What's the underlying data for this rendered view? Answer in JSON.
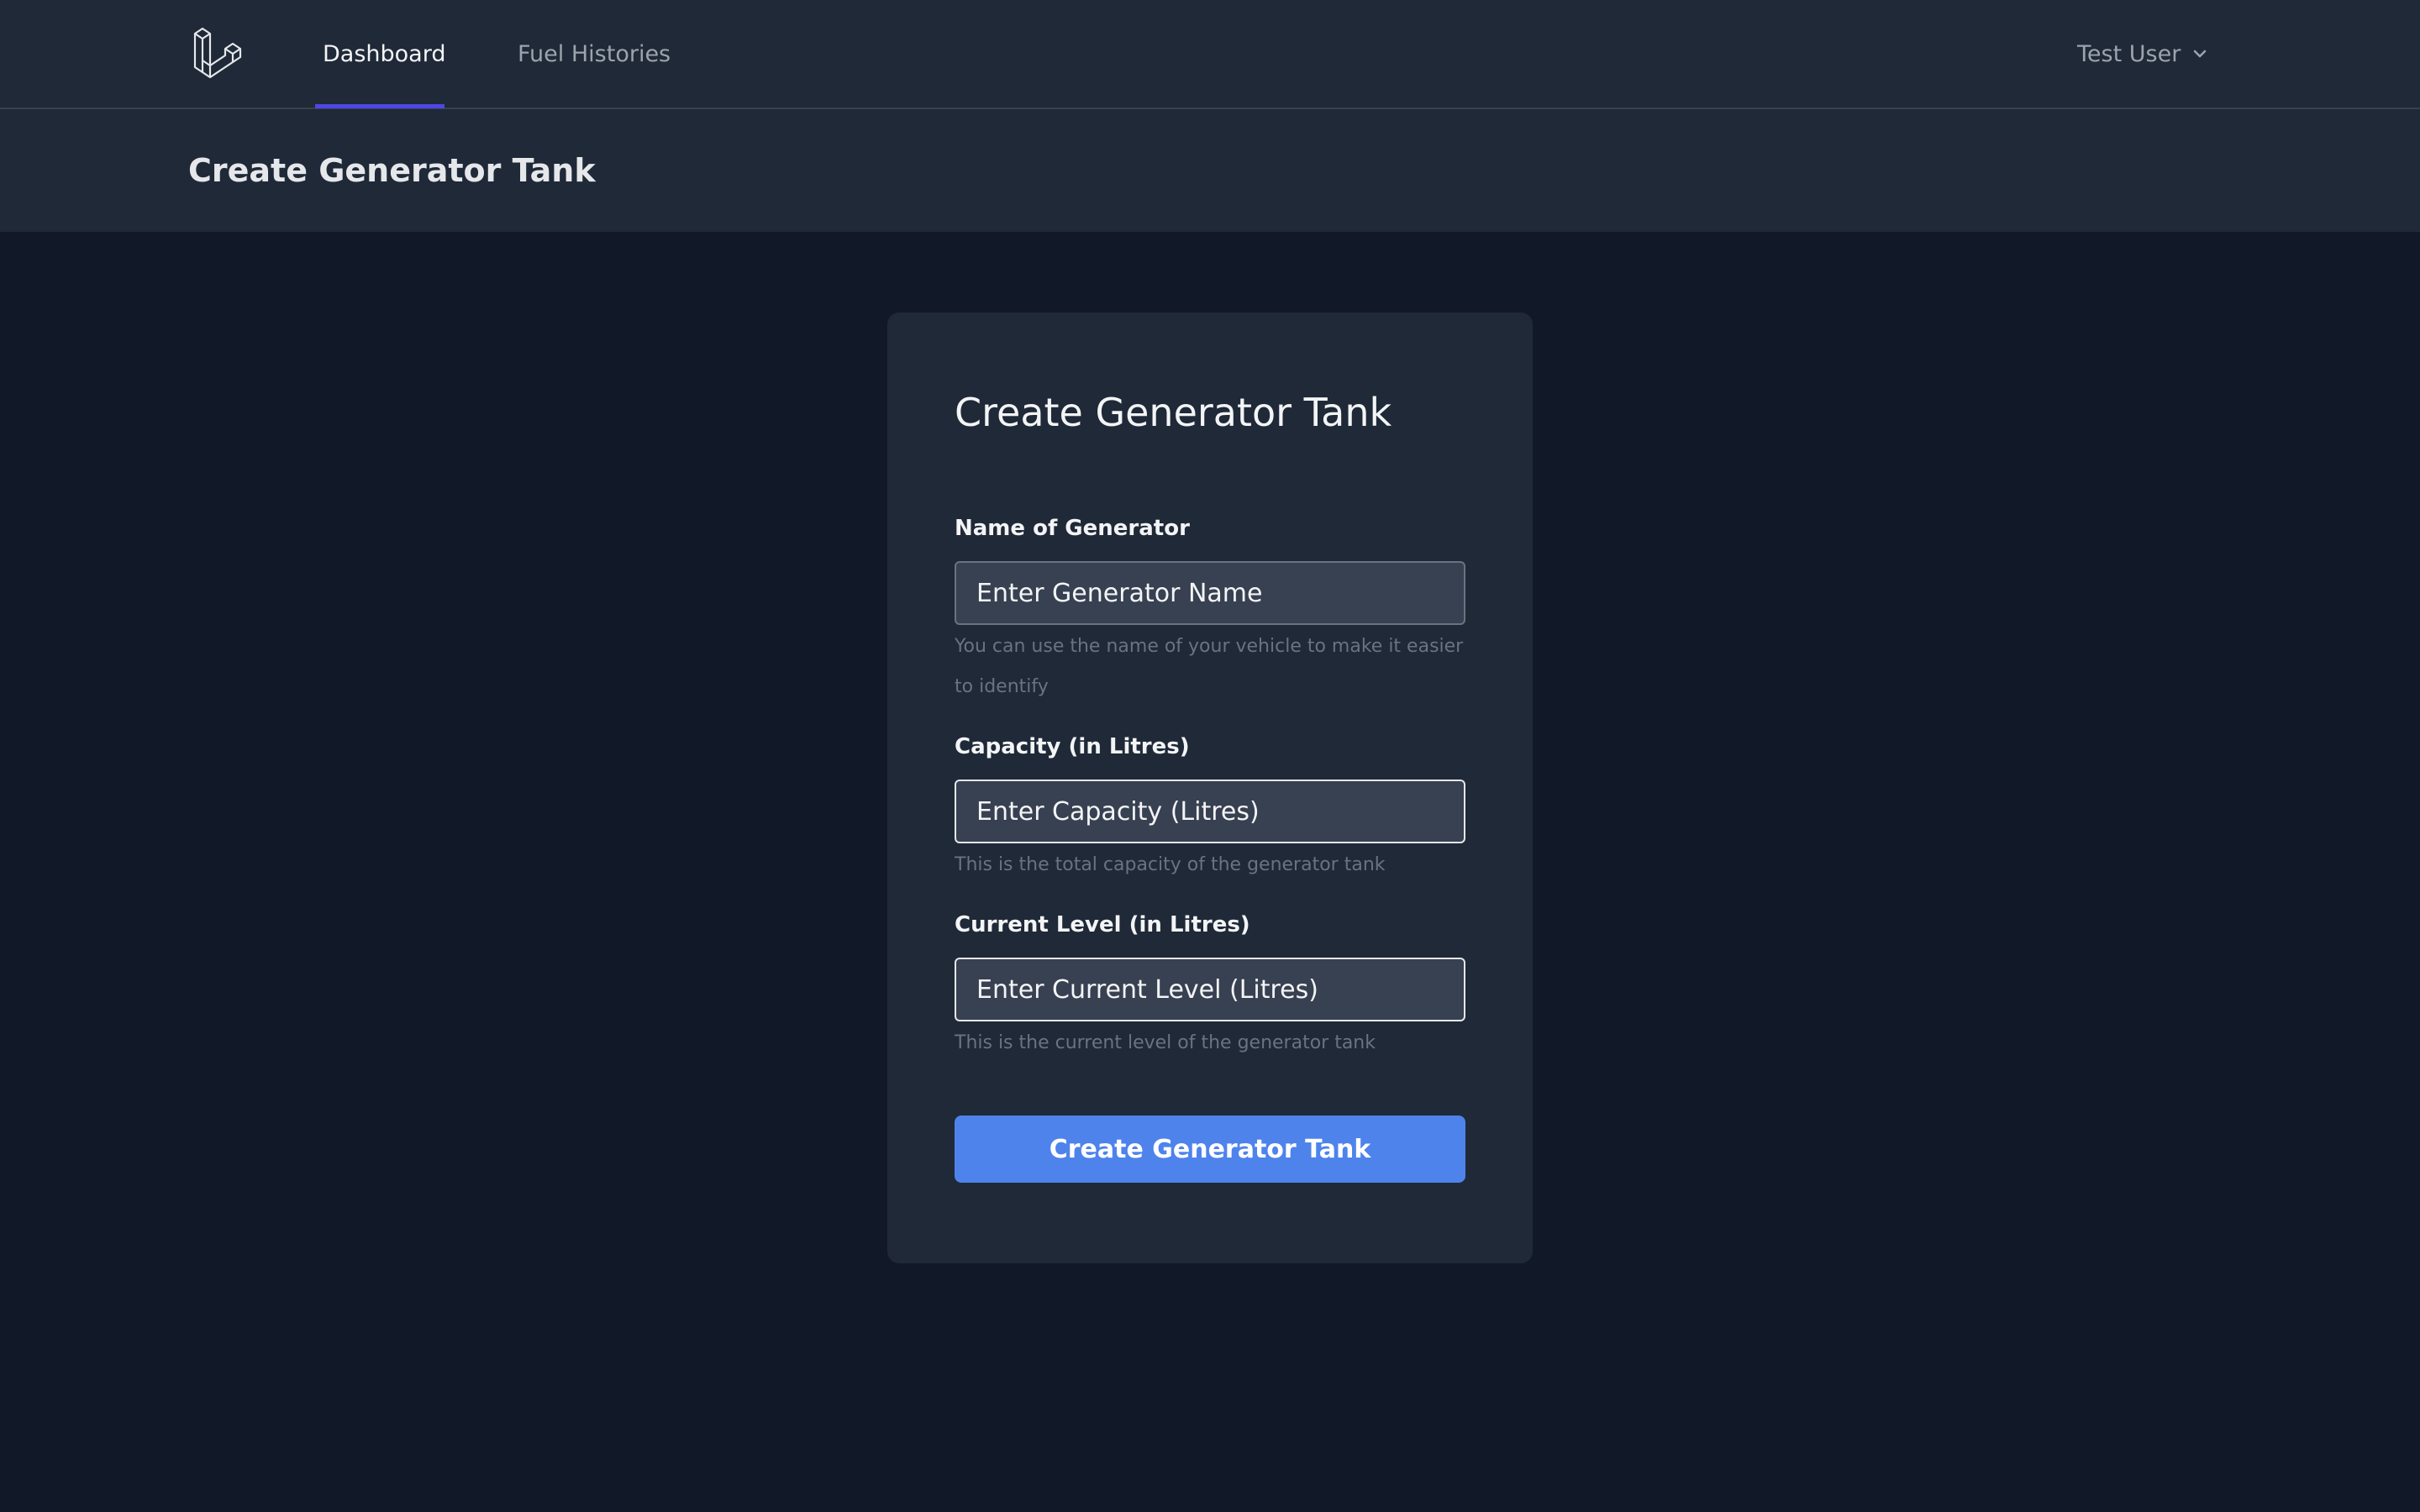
{
  "nav": {
    "logo_icon": "laravel-logo-icon",
    "links": [
      {
        "label": "Dashboard",
        "active": true
      },
      {
        "label": "Fuel Histories",
        "active": false
      }
    ],
    "user": {
      "name": "Test User",
      "icon": "chevron-down-icon"
    }
  },
  "header": {
    "title": "Create Generator Tank"
  },
  "form": {
    "title": "Create Generator Tank",
    "fields": [
      {
        "label": "Name of Generator",
        "value": "",
        "placeholder": "Enter Generator Name",
        "help": "You can use the name of your vehicle to make it easier to identify"
      },
      {
        "label": "Capacity (in Litres)",
        "value": "",
        "placeholder": "Enter Capacity (Litres)",
        "help": "This is the total capacity of the generator tank"
      },
      {
        "label": "Current Level (in Litres)",
        "value": "",
        "placeholder": "Enter Current Level (Litres)",
        "help": "This is the current level of the generator tank"
      }
    ],
    "submit_label": "Create Generator Tank"
  },
  "colors": {
    "accent_nav": "#4f46e5",
    "button": "#4f83ec",
    "background": "#111827",
    "surface": "#1f2937"
  }
}
